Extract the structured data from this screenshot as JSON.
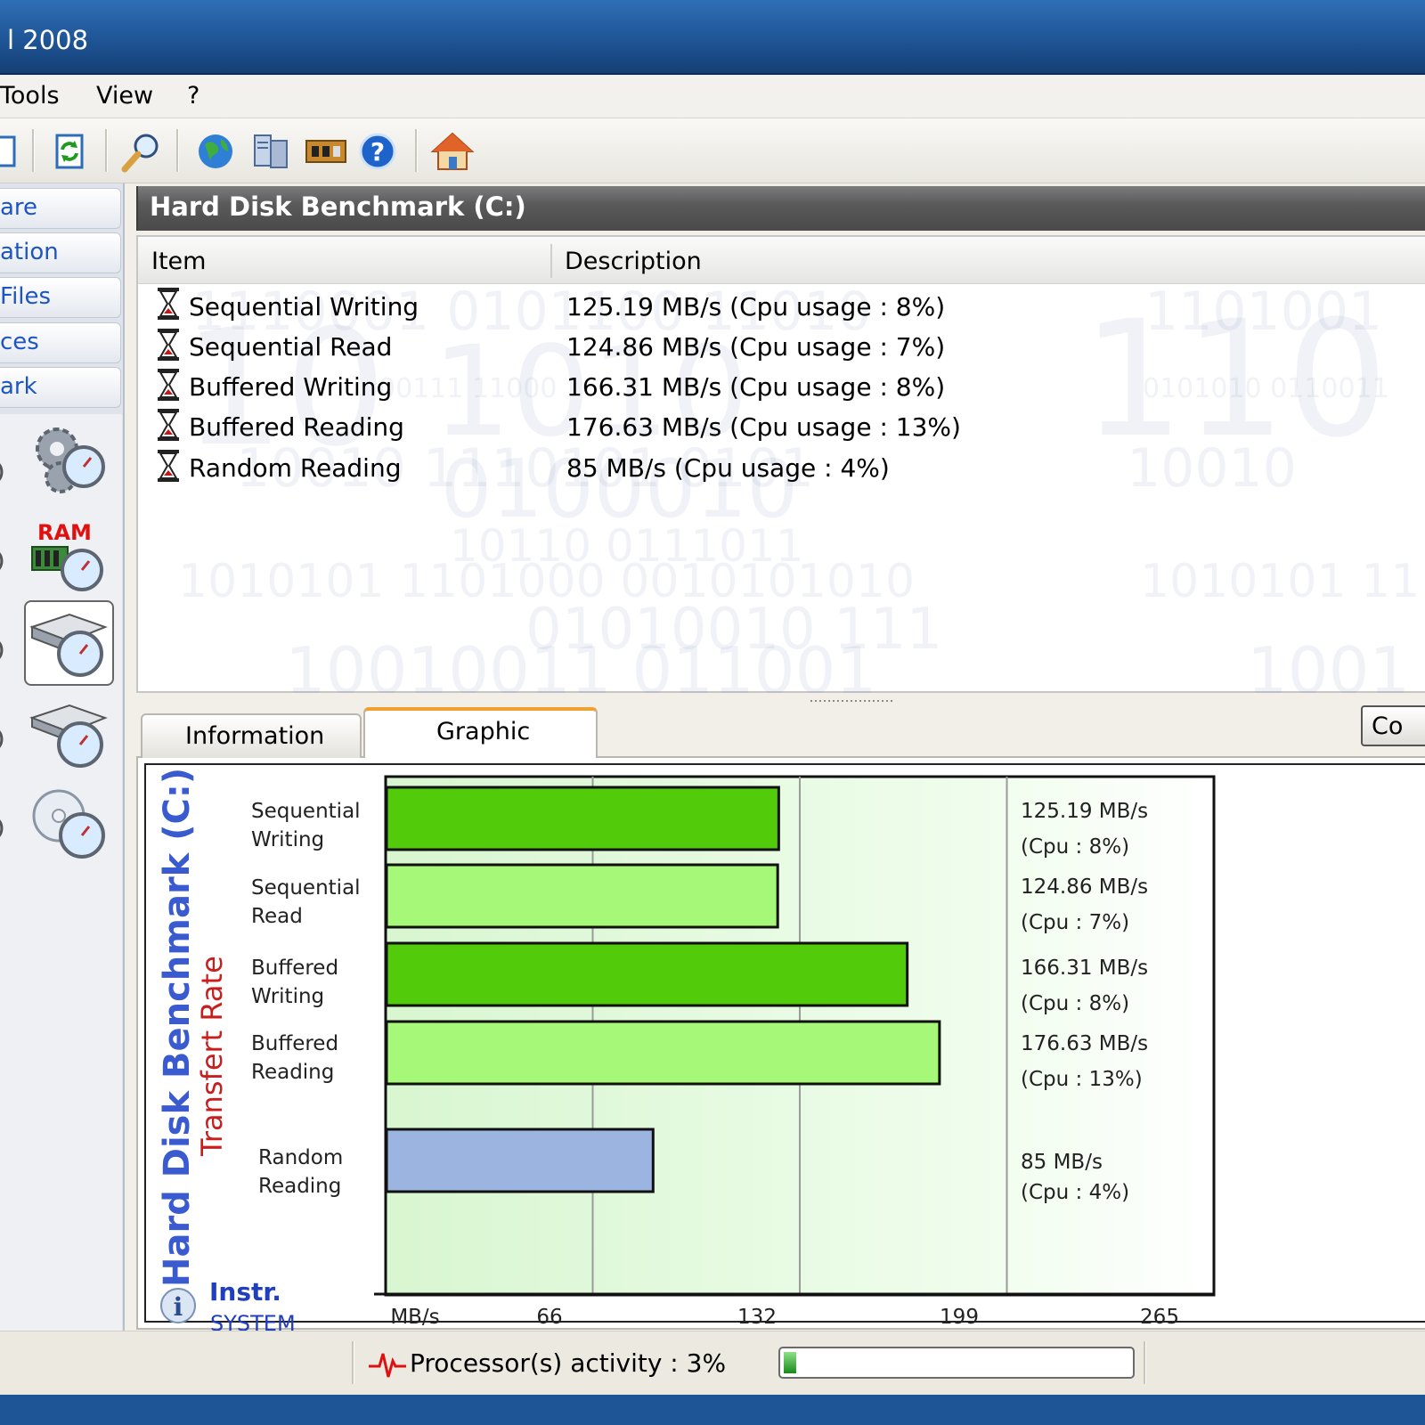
{
  "window": {
    "title": "l 2008"
  },
  "menu": [
    {
      "label": "Tools",
      "x": 0
    },
    {
      "label": "View",
      "x": 108
    },
    {
      "label": "?",
      "x": 210
    }
  ],
  "toolbar": {
    "icons": [
      "page-icon",
      "refresh-icon",
      "search-icon",
      "globe-icon",
      "network-icon",
      "hardware-icon",
      "help-icon",
      "home-icon"
    ]
  },
  "sidebar": {
    "links": [
      "are",
      "ation",
      "Files",
      "ces",
      "ark"
    ],
    "icons": [
      "gears-benchmark-icon",
      "ram-benchmark-icon",
      "hard-disk-benchmark-icon",
      "removable-disk-benchmark-icon",
      "cd-benchmark-icon"
    ],
    "ram_label": "RAM"
  },
  "panel": {
    "title": "Hard Disk Benchmark (C:)",
    "columns": [
      "Item",
      "Description"
    ],
    "rows": [
      {
        "item": "Sequential Writing",
        "description": "125.19 MB/s (Cpu usage : 8%)"
      },
      {
        "item": "Sequential Read",
        "description": "124.86 MB/s  (Cpu usage : 7%)"
      },
      {
        "item": "Buffered Writing",
        "description": "166.31 MB/s  (Cpu usage : 8%)"
      },
      {
        "item": "Buffered Reading",
        "description": "176.63 MB/s  (Cpu usage : 13%)"
      },
      {
        "item": "Random Reading",
        "description": "85 MB/s  (Cpu usage : 4%)"
      }
    ]
  },
  "tabs": {
    "information": "Information",
    "graphic": "Graphic",
    "copy_button": "Co"
  },
  "chart_data": {
    "type": "bar",
    "orientation": "horizontal",
    "title": "Hard Disk Benchmark (C:)",
    "subtitle": "Transfert Rate",
    "categories": [
      [
        "Sequential",
        "Writing"
      ],
      [
        "Sequential",
        "Read"
      ],
      [
        "Buffered",
        "Writing"
      ],
      [
        "Buffered",
        "Reading"
      ],
      [
        "Random",
        "Reading"
      ]
    ],
    "values": [
      125.19,
      124.86,
      166.31,
      176.63,
      85
    ],
    "value_labels": [
      [
        "125.19  MB/s",
        "(Cpu : 8%)"
      ],
      [
        "124.86  MB/s",
        "(Cpu : 7%)"
      ],
      [
        "166.31  MB/s",
        "(Cpu : 8%)"
      ],
      [
        "176.63  MB/s",
        "(Cpu : 13%)"
      ],
      [
        "85 MB/s",
        "(Cpu : 4%)"
      ]
    ],
    "bar_colors": [
      "#52cc0a",
      "#a6f878",
      "#52cc0a",
      "#a6f878",
      "#9bb4e0"
    ],
    "x_ticks": [
      "MB/s",
      "66",
      "132",
      "199",
      "265"
    ],
    "xlim": [
      0,
      265
    ],
    "grid": true,
    "branding": {
      "line1": "Instr.",
      "line2": "SYSTEM"
    }
  },
  "status": {
    "cpu_label": "Processor(s) activity : 3%",
    "cpu_activity": 0.03
  }
}
